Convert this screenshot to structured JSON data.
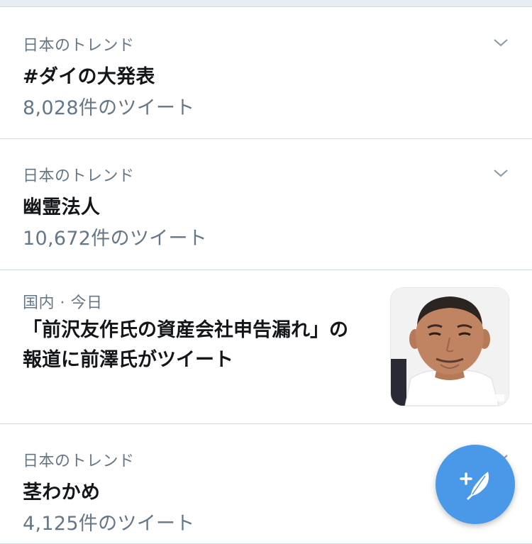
{
  "trends": [
    {
      "context": "日本のトレンド",
      "title": "#ダイの大発表",
      "count": "8,028件のツイート"
    },
    {
      "context": "日本のトレンド",
      "title": "幽霊法人",
      "count": "10,672件のツイート"
    },
    {
      "context": "日本のトレンド",
      "title": "茎わかめ",
      "count": "4,125件のツイート"
    }
  ],
  "news": {
    "context": "国内 · 今日",
    "title_line1": "「前沢友作氏の資産会社申告漏れ」の",
    "title_line2": "報道に前澤氏がツイート",
    "thumbnail": "person-photo"
  },
  "icons": {
    "more": "chevron-down-icon",
    "compose": "compose-tweet-icon"
  },
  "colors": {
    "accent": "#4a99e9",
    "secondary_text": "#657786",
    "primary_text": "#14171a",
    "divider": "#cfd9de"
  }
}
